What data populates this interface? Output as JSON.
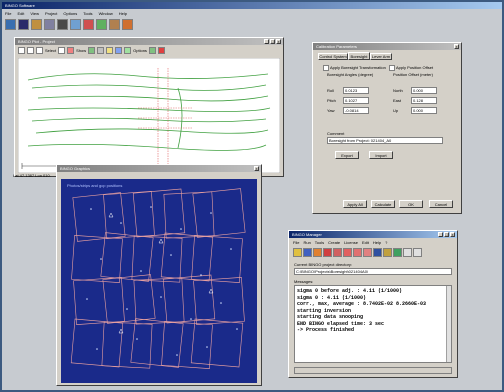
{
  "main_window": {
    "title": "BINGO Software",
    "menu": [
      "File",
      "Edit",
      "View",
      "Project",
      "Options",
      "Tools",
      "Window",
      "Help"
    ]
  },
  "plot_window": {
    "title": "BINGO Plot - Project",
    "toolbar_labels": {
      "select": "Select",
      "show": "Show",
      "options": "Options"
    }
  },
  "dialog": {
    "title": "Calibration Parameters",
    "tabs": [
      "Control System",
      "Boresight",
      "Lever Arm"
    ],
    "apply_boresight_label": "Apply Boresight Transformation",
    "apply_offset_label": "Apply Position Offset",
    "boresight_group": "Boresight Angles (degree)",
    "offset_group": "Position Offset (meter)",
    "roll_label": "Roll",
    "roll_value": "0.0123",
    "pitch_label": "Pitch",
    "pitch_value": "0.1027",
    "yaw_label": "Yaw",
    "yaw_value": "-0.0814",
    "north_label": "North",
    "north_value": "0.000",
    "east_label": "East",
    "east_value": "0.128",
    "up_label": "Up",
    "up_value": "0.000",
    "comment_label": "Comment",
    "comment_value": "Boresight from Project: 021404_A0",
    "export_label": "Export",
    "import_label": "Import",
    "apply_all_label": "Apply All",
    "calculate_label": "Calculate",
    "ok_label": "OK",
    "cancel_label": "Cancel"
  },
  "graphics_window": {
    "title": "BINGO Graphics",
    "status_text": "Lat 47.1387 Lon 010.",
    "header_text": "Photos/strips and gcp positions"
  },
  "manager_window": {
    "title": "BINGO Manager",
    "menu": [
      "File",
      "Run",
      "Tools",
      "Create",
      "License",
      "Edit",
      "Help",
      "?"
    ],
    "project_dir_label": "Current BINGO project directory:",
    "project_dir_value": "C:\\BINGO\\Projects\\Boresight\\021404A0\\",
    "messages_label": "Messages:",
    "messages": [
      "sigma 0 before adj. :         4.11 (1/1000)",
      "sigma 0 :                     4.11 (1/1000)",
      "corr., max, average :  8.7402E-02  8.2660E-03",
      "starting inversion",
      "starting data snooping",
      "END BINGO elapsed time: 3 sec",
      "-> Process finished"
    ]
  },
  "colors": {
    "title_active": "#0a2468",
    "desktop": "#c7cbd0",
    "plot_bg": "#1a2a8a",
    "strip_line": "#e8a0a0"
  }
}
